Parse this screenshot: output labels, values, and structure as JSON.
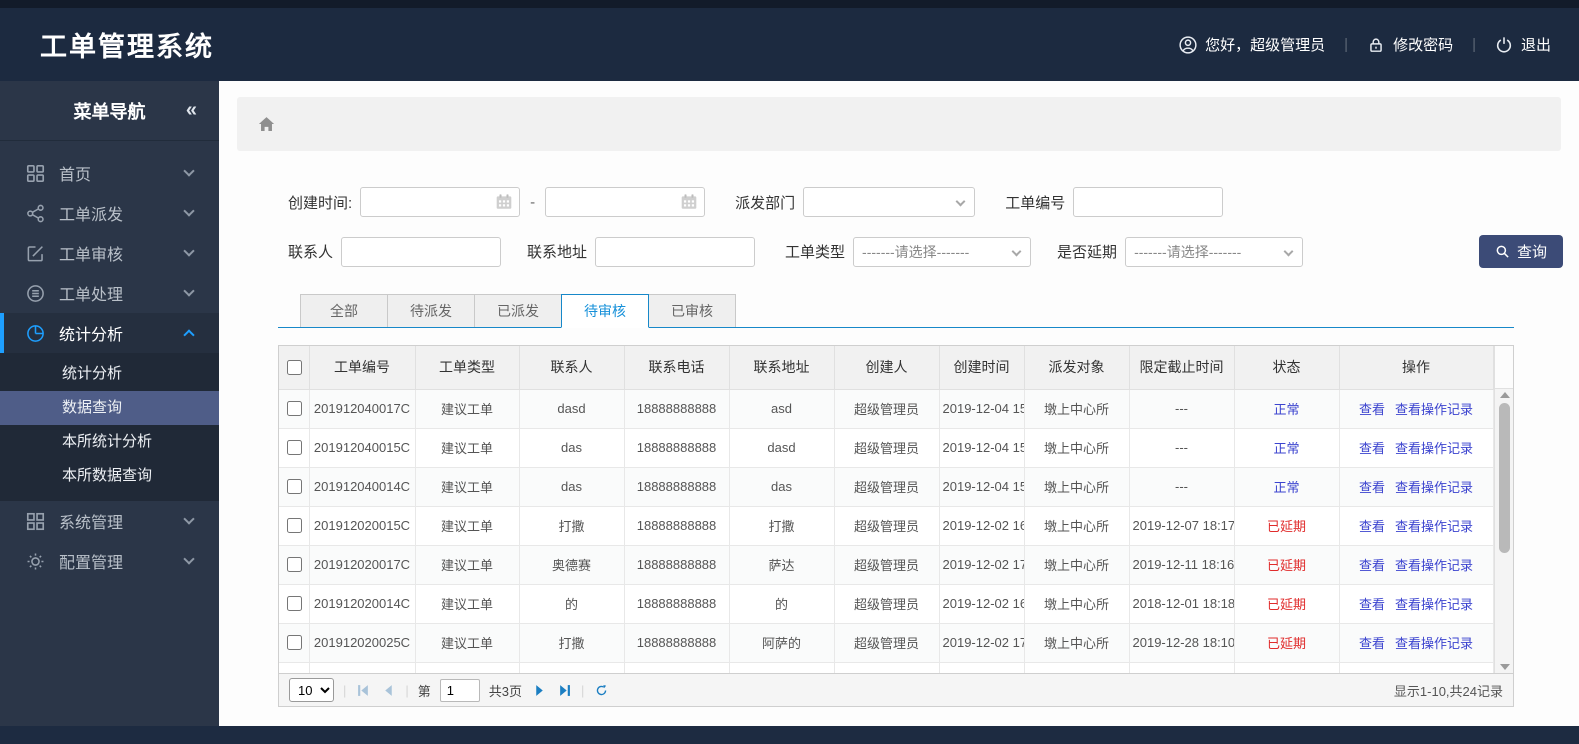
{
  "app": {
    "title": "工单管理系统"
  },
  "userbar": {
    "greeting": "您好，超级管理员",
    "change_password": "修改密码",
    "logout": "退出",
    "icons": {
      "user": "person-circle",
      "lock": "padlock",
      "power": "power-symbol"
    }
  },
  "colors": {
    "header_bg": "#1c2a40",
    "sidebar_bg": "#2b3648",
    "accent_blue": "#1e9fff",
    "tab_active": "#1690d9",
    "search_button": "#3c4b77",
    "status_normal": "#3b43cf",
    "status_delayed": "#e02b2b",
    "link": "#3b43cf"
  },
  "sidebar": {
    "title": "菜单导航",
    "collapse_glyph": "«",
    "items": [
      {
        "label": "首页",
        "icon": "grid-icon"
      },
      {
        "label": "工单派发",
        "icon": "share-icon"
      },
      {
        "label": "工单审核",
        "icon": "edit-icon"
      },
      {
        "label": "工单处理",
        "icon": "process-icon"
      },
      {
        "label": "统计分析",
        "icon": "pie-chart-icon",
        "expanded": true,
        "children": [
          "统计分析",
          "数据查询",
          "本所统计分析",
          "本所数据查询"
        ],
        "active_child": "数据查询"
      },
      {
        "label": "系统管理",
        "icon": "grid-icon"
      },
      {
        "label": "配置管理",
        "icon": "gear-icon"
      }
    ]
  },
  "filters": {
    "created_label": "创建时间:",
    "range_separator": "-",
    "dept_label": "派发部门",
    "order_no_label": "工单编号",
    "contact_label": "联系人",
    "address_label": "联系地址",
    "type_label": "工单类型",
    "type_value": "-------请选择-------",
    "delay_label": "是否延期",
    "delay_value": "-------请选择-------",
    "search_label": "查询"
  },
  "tabs": [
    {
      "label": "全部"
    },
    {
      "label": "待派发"
    },
    {
      "label": "已派发"
    },
    {
      "label": "待审核",
      "active": true
    },
    {
      "label": "已审核"
    }
  ],
  "table": {
    "columns": [
      "工单编号",
      "工单类型",
      "联系人",
      "联系电话",
      "联系地址",
      "创建人",
      "创建时间",
      "派发对象",
      "限定截止时间",
      "状态",
      "操作"
    ],
    "rows": [
      {
        "no": "201912040017C",
        "type": "建议工单",
        "contact": "dasd",
        "phone": "18888888888",
        "address": "asd",
        "creator": "超级管理员",
        "created": "2019-12-04 15",
        "target": "墩上中心所",
        "deadline": "---",
        "status": "正常",
        "state": "normal",
        "view": "查看",
        "log": "查看操作记录"
      },
      {
        "no": "201912040015C",
        "type": "建议工单",
        "contact": "das",
        "phone": "18888888888",
        "address": "dasd",
        "creator": "超级管理员",
        "created": "2019-12-04 15",
        "target": "墩上中心所",
        "deadline": "---",
        "status": "正常",
        "state": "normal",
        "view": "查看",
        "log": "查看操作记录"
      },
      {
        "no": "201912040014C",
        "type": "建议工单",
        "contact": "das",
        "phone": "18888888888",
        "address": "das",
        "creator": "超级管理员",
        "created": "2019-12-04 15",
        "target": "墩上中心所",
        "deadline": "---",
        "status": "正常",
        "state": "normal",
        "view": "查看",
        "log": "查看操作记录"
      },
      {
        "no": "201912020015C",
        "type": "建议工单",
        "contact": "打撒",
        "phone": "18888888888",
        "address": "打撒",
        "creator": "超级管理员",
        "created": "2019-12-02 16",
        "target": "墩上中心所",
        "deadline": "2019-12-07 18:17",
        "status": "已延期",
        "state": "delayed",
        "view": "查看",
        "log": "查看操作记录"
      },
      {
        "no": "201912020017C",
        "type": "建议工单",
        "contact": "奥德赛",
        "phone": "18888888888",
        "address": "萨达",
        "creator": "超级管理员",
        "created": "2019-12-02 17",
        "target": "墩上中心所",
        "deadline": "2019-12-11 18:16",
        "status": "已延期",
        "state": "delayed",
        "view": "查看",
        "log": "查看操作记录"
      },
      {
        "no": "201912020014C",
        "type": "建议工单",
        "contact": "的",
        "phone": "18888888888",
        "address": "的",
        "creator": "超级管理员",
        "created": "2019-12-02 16",
        "target": "墩上中心所",
        "deadline": "2018-12-01 18:18",
        "status": "已延期",
        "state": "delayed",
        "view": "查看",
        "log": "查看操作记录"
      },
      {
        "no": "201912020025C",
        "type": "建议工单",
        "contact": "打撒",
        "phone": "18888888888",
        "address": "阿萨的",
        "creator": "超级管理员",
        "created": "2019-12-02 17",
        "target": "墩上中心所",
        "deadline": "2019-12-28 18:10",
        "status": "已延期",
        "state": "delayed",
        "view": "查看",
        "log": "查看操作记录"
      }
    ]
  },
  "pagination": {
    "page_size": "10",
    "page_prefix": "第",
    "page": "1",
    "total_pages": "共3页",
    "info": "显示1-10,共24记录"
  }
}
